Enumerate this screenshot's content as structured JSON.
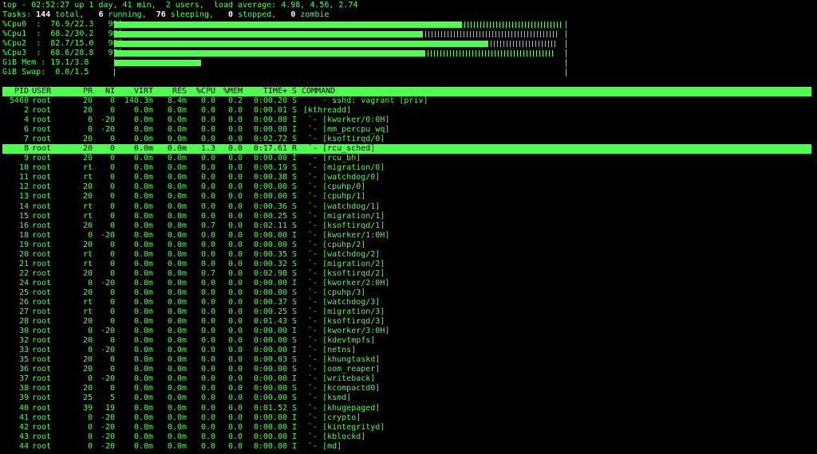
{
  "summary": {
    "top_line": "top - 02:52:27 up 1 day, 41 min,  2 users,  load average: 4.98, 4.56, 2.74",
    "tasks": {
      "label": "Tasks:",
      "total": "144",
      "total_l": "total,",
      "running": "6",
      "running_l": "running,",
      "sleeping": "76",
      "sleeping_l": "sleeping,",
      "stopped": "0",
      "stopped_l": "stopped,",
      "zombie": "0",
      "zombie_l": "zombie"
    }
  },
  "cpus": [
    {
      "label": "%Cpu0  :  76.9/22.3   99[",
      "user_pct": 76.9,
      "sys_pct": 22.3
    },
    {
      "label": "%Cpu1  :  68.2/30.2   98[",
      "user_pct": 68.2,
      "sys_pct": 30.2
    },
    {
      "label": "%Cpu2  :  82.7/15.0   98[",
      "user_pct": 82.7,
      "sys_pct": 15.0
    },
    {
      "label": "%Cpu3  :  68.6/28.8   97[",
      "user_pct": 68.6,
      "sys_pct": 28.8
    }
  ],
  "mem": {
    "label": "GiB Mem : 19.1/3.8",
    "used_pct": 19.1
  },
  "swap": {
    "label": "GiB Swap:  0.0/1.5",
    "used_pct": 0.0
  },
  "columns": [
    "PID",
    "USER",
    "PR",
    "NI",
    "VIRT",
    "RES",
    "%CPU",
    "%MEM",
    "TIME+",
    "S",
    "COMMAND"
  ],
  "processes": [
    [
      "5460",
      "root",
      "20",
      "0",
      "140.3m",
      "8.4m",
      "0.0",
      "0.2",
      "0:00.20",
      "S",
      "    - sshd: vagrant [priv]"
    ],
    [
      "2",
      "root",
      "20",
      "0",
      "0.0m",
      "0.0m",
      "0.0",
      "0.0",
      "0:00.01",
      "S",
      "[kthreadd]"
    ],
    [
      "4",
      "root",
      "0",
      "-20",
      "0.0m",
      "0.0m",
      "0.0",
      "0.0",
      "0:00.00",
      "I",
      " `- [kworker/0:0H]"
    ],
    [
      "6",
      "root",
      "0",
      "-20",
      "0.0m",
      "0.0m",
      "0.0",
      "0.0",
      "0:00.00",
      "I",
      " `- [mm_percpu_wq]"
    ],
    [
      "7",
      "root",
      "20",
      "0",
      "0.0m",
      "0.0m",
      "0.0",
      "0.0",
      "0:02.72",
      "S",
      " `- [ksoftirqd/0]"
    ],
    [
      "8",
      "root",
      "20",
      "0",
      "0.0m",
      "0.0m",
      "1.3",
      "0.0",
      "0:17.61",
      "R",
      " `- [rcu_sched]"
    ],
    [
      "9",
      "root",
      "20",
      "0",
      "0.0m",
      "0.0m",
      "0.0",
      "0.0",
      "0:00.00",
      "I",
      " `- [rcu_bh]"
    ],
    [
      "10",
      "root",
      "rt",
      "0",
      "0.0m",
      "0.0m",
      "0.0",
      "0.0",
      "0:00.19",
      "S",
      " `- [migration/0]"
    ],
    [
      "11",
      "root",
      "rt",
      "0",
      "0.0m",
      "0.0m",
      "0.0",
      "0.0",
      "0:00.38",
      "S",
      " `- [watchdog/0]"
    ],
    [
      "12",
      "root",
      "20",
      "0",
      "0.0m",
      "0.0m",
      "0.0",
      "0.0",
      "0:00.00",
      "S",
      " `- [cpuhp/0]"
    ],
    [
      "13",
      "root",
      "20",
      "0",
      "0.0m",
      "0.0m",
      "0.0",
      "0.0",
      "0:00.00",
      "S",
      " `- [cpuhp/1]"
    ],
    [
      "14",
      "root",
      "rt",
      "0",
      "0.0m",
      "0.0m",
      "0.0",
      "0.0",
      "0:00.36",
      "S",
      " `- [watchdog/1]"
    ],
    [
      "15",
      "root",
      "rt",
      "0",
      "0.0m",
      "0.0m",
      "0.0",
      "0.0",
      "0:00.25",
      "S",
      " `- [migration/1]"
    ],
    [
      "16",
      "root",
      "20",
      "0",
      "0.0m",
      "0.0m",
      "0.7",
      "0.0",
      "0:02.11",
      "S",
      " `- [ksoftirqd/1]"
    ],
    [
      "18",
      "root",
      "0",
      "-20",
      "0.0m",
      "0.0m",
      "0.0",
      "0.0",
      "0:00.00",
      "I",
      " `- [kworker/1:0H]"
    ],
    [
      "19",
      "root",
      "20",
      "0",
      "0.0m",
      "0.0m",
      "0.0",
      "0.0",
      "0:00.00",
      "S",
      " `- [cpuhp/2]"
    ],
    [
      "20",
      "root",
      "rt",
      "0",
      "0.0m",
      "0.0m",
      "0.0",
      "0.0",
      "0:00.35",
      "S",
      " `- [watchdog/2]"
    ],
    [
      "21",
      "root",
      "rt",
      "0",
      "0.0m",
      "0.0m",
      "0.0",
      "0.0",
      "0:00.32",
      "S",
      " `- [migration/2]"
    ],
    [
      "22",
      "root",
      "20",
      "0",
      "0.0m",
      "0.0m",
      "0.7",
      "0.0",
      "0:02.98",
      "S",
      " `- [ksoftirqd/2]"
    ],
    [
      "24",
      "root",
      "0",
      "-20",
      "0.0m",
      "0.0m",
      "0.0",
      "0.0",
      "0:00.00",
      "I",
      " `- [kworker/2:0H]"
    ],
    [
      "25",
      "root",
      "20",
      "0",
      "0.0m",
      "0.0m",
      "0.0",
      "0.0",
      "0:00.00",
      "S",
      " `- [cpuhp/3]"
    ],
    [
      "26",
      "root",
      "rt",
      "0",
      "0.0m",
      "0.0m",
      "0.0",
      "0.0",
      "0:00.37",
      "S",
      " `- [watchdog/3]"
    ],
    [
      "27",
      "root",
      "rt",
      "0",
      "0.0m",
      "0.0m",
      "0.0",
      "0.0",
      "0:00.25",
      "S",
      " `- [migration/3]"
    ],
    [
      "28",
      "root",
      "20",
      "0",
      "0.0m",
      "0.0m",
      "0.0",
      "0.0",
      "0:01.43",
      "S",
      " `- [ksoftirqd/3]"
    ],
    [
      "30",
      "root",
      "0",
      "-20",
      "0.0m",
      "0.0m",
      "0.0",
      "0.0",
      "0:00.00",
      "I",
      " `- [kworker/3:0H]"
    ],
    [
      "32",
      "root",
      "20",
      "0",
      "0.0m",
      "0.0m",
      "0.0",
      "0.0",
      "0:00.00",
      "S",
      " `- [kdevtmpfs]"
    ],
    [
      "33",
      "root",
      "0",
      "-20",
      "0.0m",
      "0.0m",
      "0.0",
      "0.0",
      "0:00.00",
      "I",
      " `- [netns]"
    ],
    [
      "35",
      "root",
      "20",
      "0",
      "0.0m",
      "0.0m",
      "0.0",
      "0.0",
      "0:00.03",
      "S",
      " `- [khungtaskd]"
    ],
    [
      "36",
      "root",
      "20",
      "0",
      "0.0m",
      "0.0m",
      "0.0",
      "0.0",
      "0:00.00",
      "S",
      " `- [oom_reaper]"
    ],
    [
      "37",
      "root",
      "0",
      "-20",
      "0.0m",
      "0.0m",
      "0.0",
      "0.0",
      "0:00.00",
      "I",
      " `- [writeback]"
    ],
    [
      "38",
      "root",
      "20",
      "0",
      "0.0m",
      "0.0m",
      "0.0",
      "0.0",
      "0:00.00",
      "S",
      " `- [kcompactd0]"
    ],
    [
      "39",
      "root",
      "25",
      "5",
      "0.0m",
      "0.0m",
      "0.0",
      "0.0",
      "0:00.00",
      "S",
      " `- [ksmd]"
    ],
    [
      "40",
      "root",
      "39",
      "19",
      "0.0m",
      "0.0m",
      "0.0",
      "0.0",
      "0:01.52",
      "S",
      " `- [khugepaged]"
    ],
    [
      "41",
      "root",
      "0",
      "-20",
      "0.0m",
      "0.0m",
      "0.0",
      "0.0",
      "0:00.00",
      "I",
      " `- [crypto]"
    ],
    [
      "42",
      "root",
      "0",
      "-20",
      "0.0m",
      "0.0m",
      "0.0",
      "0.0",
      "0:00.00",
      "I",
      " `- [kintegrityd]"
    ],
    [
      "43",
      "root",
      "0",
      "-20",
      "0.0m",
      "0.0m",
      "0.0",
      "0.0",
      "0:00.00",
      "I",
      " `- [kblockd]"
    ],
    [
      "44",
      "root",
      "0",
      "-20",
      "0.0m",
      "0.0m",
      "0.0",
      "0.0",
      "0:00.00",
      "I",
      " `- [md]"
    ]
  ],
  "selected_pid": "8",
  "colors": {
    "fg": "#4dff4d",
    "bg": "#000000",
    "highlight_text": "#ffffff"
  }
}
